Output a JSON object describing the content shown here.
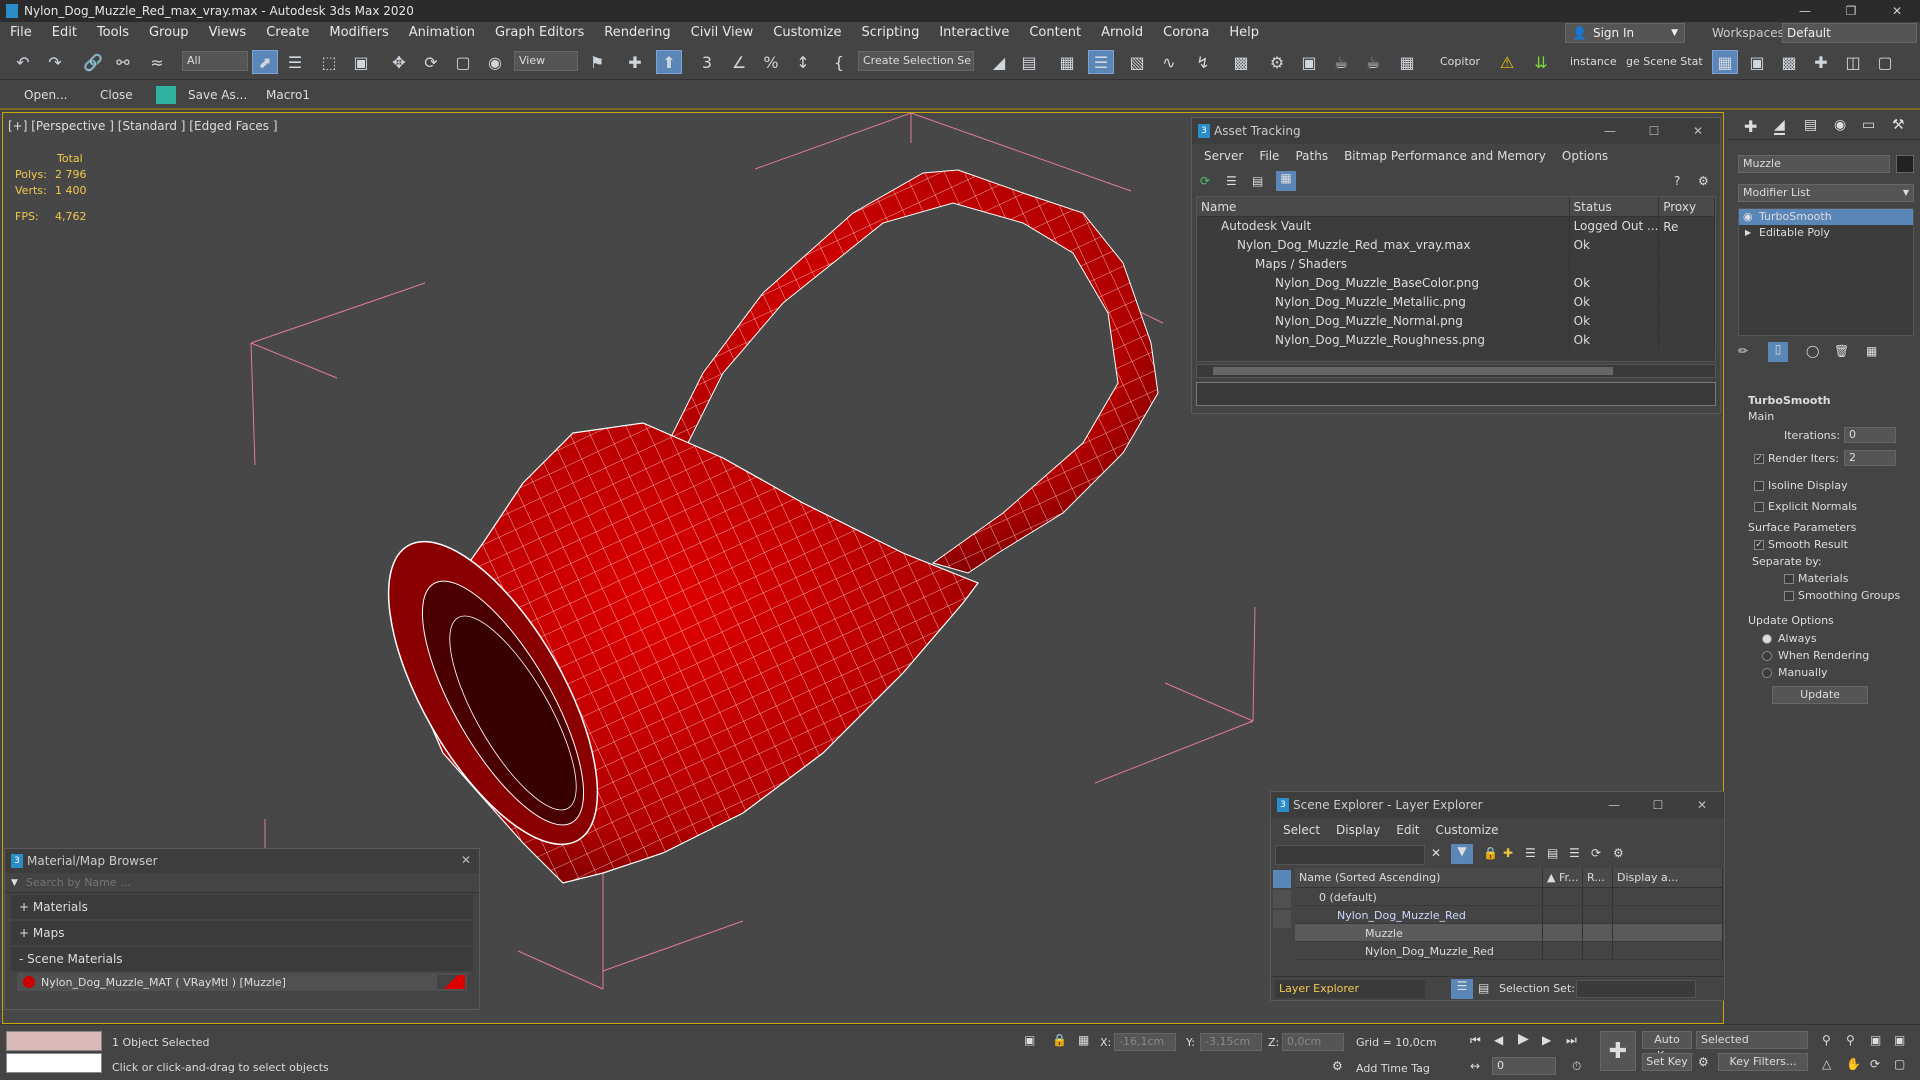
{
  "window": {
    "title": "Nylon_Dog_Muzzle_Red_max_vray.max - Autodesk 3ds Max 2020"
  },
  "menu": [
    "File",
    "Edit",
    "Tools",
    "Group",
    "Views",
    "Create",
    "Modifiers",
    "Animation",
    "Graph Editors",
    "Rendering",
    "Civil View",
    "Customize",
    "Scripting",
    "Interactive",
    "Content",
    "Arnold",
    "Corona",
    "Help"
  ],
  "account": {
    "sign_in": "Sign In",
    "workspaces_label": "Workspaces:",
    "workspace": "Default"
  },
  "toolbar": {
    "filter": "All",
    "ref_coord": "View",
    "selection_set": "Create Selection Se",
    "copitor": "Copitor",
    "instance": "instance",
    "scene_stat": "ge Scene Stat"
  },
  "toolbar2": {
    "open": "Open...",
    "close": "Close",
    "save_as": "Save As...",
    "macro": "Macro1"
  },
  "viewport": {
    "label": "[+] [Perspective ] [Standard ] [Edged Faces ]",
    "stats_header": "Total",
    "polys_label": "Polys:",
    "polys": "2 796",
    "verts_label": "Verts:",
    "verts": "1 400",
    "fps_label": "FPS:",
    "fps": "4,762",
    "model_color": "#c80000"
  },
  "asset_tracking": {
    "title": "Asset Tracking",
    "menu": [
      "Server",
      "File",
      "Paths",
      "Bitmap Performance and Memory",
      "Options"
    ],
    "columns": [
      "Name",
      "Status",
      "Proxy Re"
    ],
    "rows": [
      {
        "name": "Autodesk Vault",
        "status": "Logged Out ..."
      },
      {
        "name": "Nylon_Dog_Muzzle_Red_max_vray.max",
        "status": "Ok"
      },
      {
        "name": "Maps / Shaders",
        "status": ""
      },
      {
        "name": "Nylon_Dog_Muzzle_BaseColor.png",
        "status": "Ok"
      },
      {
        "name": "Nylon_Dog_Muzzle_Metallic.png",
        "status": "Ok"
      },
      {
        "name": "Nylon_Dog_Muzzle_Normal.png",
        "status": "Ok"
      },
      {
        "name": "Nylon_Dog_Muzzle_Roughness.png",
        "status": "Ok"
      }
    ]
  },
  "material_browser": {
    "title": "Material/Map Browser",
    "search_placeholder": "Search by Name ...",
    "groups": [
      "+ Materials",
      "+ Maps",
      "- Scene Materials"
    ],
    "scene_material": "Nylon_Dog_Muzzle_MAT  ( VRayMtl )  [Muzzle]"
  },
  "scene_explorer": {
    "title": "Scene Explorer - Layer Explorer",
    "menu": [
      "Select",
      "Display",
      "Edit",
      "Customize"
    ],
    "columns": [
      "Name (Sorted Ascending)",
      "▲ Fr...",
      "R...",
      "Display a..."
    ],
    "rows": [
      "0 (default)",
      "Nylon_Dog_Muzzle_Red",
      "Muzzle",
      "Nylon_Dog_Muzzle_Red"
    ],
    "footer_layer": "Layer Explorer",
    "selection_set_label": "Selection Set:"
  },
  "command_panel": {
    "object_name": "Muzzle",
    "modifier_list": "Modifier List",
    "stack": [
      "TurboSmooth",
      "Editable Poly"
    ],
    "rollout": "TurboSmooth",
    "main": "Main",
    "iterations_label": "Iterations:",
    "iterations": "0",
    "render_iters_label": "Render Iters:",
    "render_iters": "2",
    "isoline": "Isoline Display",
    "explicit_normals": "Explicit Normals",
    "surface_params": "Surface Parameters",
    "smooth_result": "Smooth Result",
    "separate_by": "Separate by:",
    "materials": "Materials",
    "smoothing_groups": "Smoothing Groups",
    "update_options": "Update Options",
    "always": "Always",
    "when_rendering": "When Rendering",
    "manually": "Manually",
    "update_btn": "Update"
  },
  "status": {
    "selected": "1 Object Selected",
    "hint": "Click or click-and-drag to select objects",
    "x_label": "X:",
    "x": "-16,1cm",
    "y_label": "Y:",
    "y": "-3,15cm",
    "z_label": "Z:",
    "z": "0,0cm",
    "grid": "Grid = 10,0cm",
    "add_time_tag": "Add Time Tag",
    "auto_key": "Auto Key",
    "key_mode": "Selected",
    "set_key": "Set Key",
    "key_filters": "Key Filters...",
    "frame": "0"
  }
}
